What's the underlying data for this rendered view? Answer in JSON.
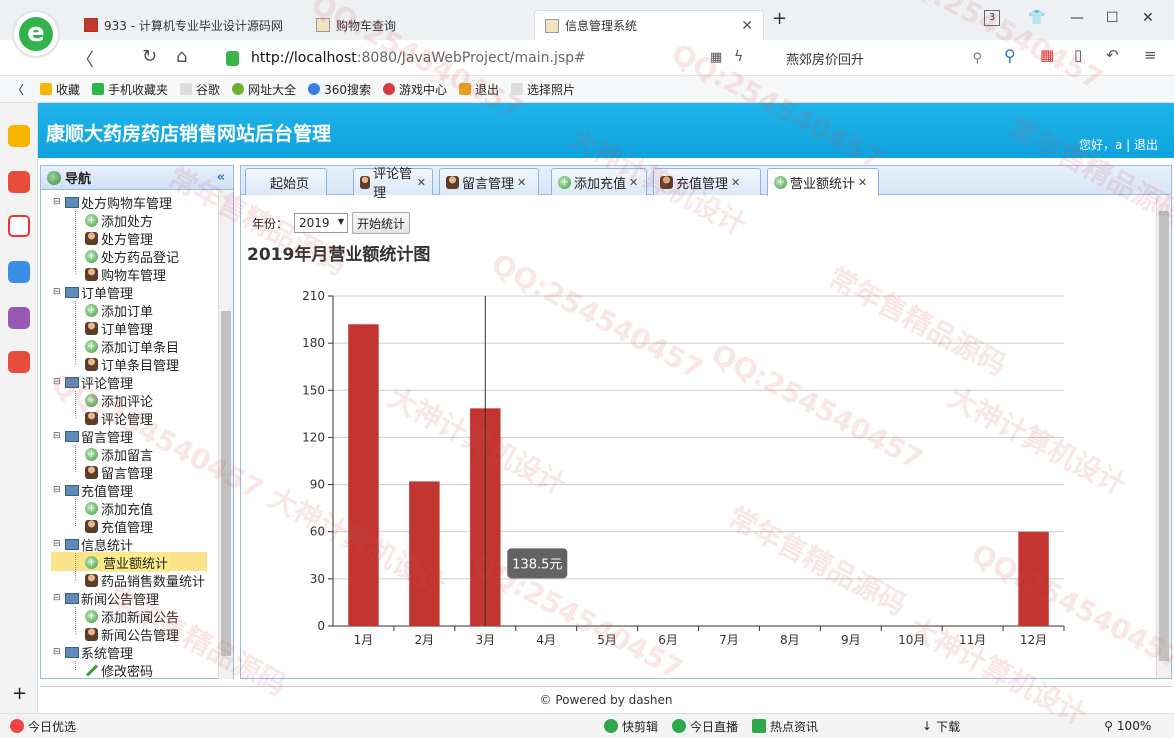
{
  "browser": {
    "tabs": [
      {
        "label": "933 - 计算机专业毕业设计源码网",
        "active": false
      },
      {
        "label": "购物车查询",
        "active": false
      },
      {
        "label": "信息管理系统",
        "active": true
      }
    ],
    "new_tab": "+",
    "tab_count": "3",
    "url_host": "http://localhost",
    "url_rest": ":8080/JavaWebProject/main.jsp#",
    "search_text": "燕郊房价回升",
    "bookmarks": [
      "收藏",
      "手机收藏夹",
      "谷歌",
      "网址大全",
      "360搜索",
      "游戏中心",
      "退出",
      "选择照片"
    ],
    "status_left": "今日优选",
    "status_items": [
      "快剪辑",
      "今日直播",
      "热点资讯",
      "下载"
    ],
    "zoom": "100%"
  },
  "app": {
    "title": "康顺大药房药店销售网站后台管理",
    "greeting": "您好，a | 退出",
    "footer": "© Powered by dashen"
  },
  "nav": {
    "header": "导航",
    "collapse": "«",
    "groups": [
      {
        "label": "处方购物车管理",
        "items": [
          "添加处方",
          "处方管理",
          "处方药品登记",
          "购物车管理"
        ]
      },
      {
        "label": "订单管理",
        "items": [
          "添加订单",
          "订单管理",
          "添加订单条目",
          "订单条目管理"
        ]
      },
      {
        "label": "评论管理",
        "items": [
          "添加评论",
          "评论管理"
        ]
      },
      {
        "label": "留言管理",
        "items": [
          "添加留言",
          "留言管理"
        ]
      },
      {
        "label": "充值管理",
        "items": [
          "添加充值",
          "充值管理"
        ]
      },
      {
        "label": "信息统计",
        "items": [
          "营业额统计",
          "药品销售数量统计"
        ]
      },
      {
        "label": "新闻公告管理",
        "items": [
          "添加新闻公告",
          "新闻公告管理"
        ]
      },
      {
        "label": "系统管理",
        "items": [
          "修改密码"
        ]
      }
    ],
    "selected": "营业额统计"
  },
  "page_tabs": [
    {
      "label": "起始页",
      "closable": false,
      "icon": "none"
    },
    {
      "label": "评论管理",
      "closable": true,
      "icon": "user-icon"
    },
    {
      "label": "留言管理",
      "closable": true,
      "icon": "user-icon"
    },
    {
      "label": "添加充值",
      "closable": true,
      "icon": "plus-icon"
    },
    {
      "label": "充值管理",
      "closable": true,
      "icon": "user-icon"
    },
    {
      "label": "营业额统计",
      "closable": true,
      "icon": "plus-icon",
      "active": true
    }
  ],
  "filter": {
    "year_label": "年份：",
    "year_value": "2019",
    "button": "开始统计"
  },
  "chart_title": "2019年月营业额统计图",
  "chart_data": {
    "type": "bar",
    "title": "2019年月营业额统计图",
    "categories": [
      "1月",
      "2月",
      "3月",
      "4月",
      "5月",
      "6月",
      "7月",
      "8月",
      "9月",
      "10月",
      "11月",
      "12月"
    ],
    "values": [
      192,
      92,
      138.5,
      0,
      0,
      0,
      0,
      0,
      0,
      0,
      0,
      60
    ],
    "ylim": [
      0,
      210
    ],
    "yticks": [
      0,
      30,
      60,
      90,
      120,
      150,
      180,
      210
    ],
    "grid": true,
    "bar_color": "#c23531",
    "tooltip": {
      "category": "3月",
      "text": "138.5元"
    }
  },
  "watermarks": [
    "QQ:254540457",
    "大神计算机设计",
    "常年售精品源码"
  ]
}
